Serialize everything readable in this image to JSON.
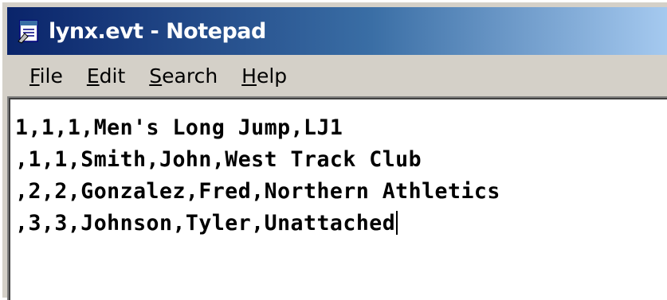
{
  "window": {
    "title": "lynx.evt - Notepad",
    "icon": "notepad-icon"
  },
  "menu": {
    "items": [
      {
        "label_first": "F",
        "label_rest": "ile"
      },
      {
        "label_first": "E",
        "label_rest": "dit"
      },
      {
        "label_first": "S",
        "label_rest": "earch"
      },
      {
        "label_first": "H",
        "label_rest": "elp"
      }
    ]
  },
  "editor": {
    "lines": [
      "1,1,1,Men's Long Jump,LJ1",
      ",1,1,Smith,John,West Track Club",
      ",2,2,Gonzalez,Fred,Northern Athletics",
      ",3,3,Johnson,Tyler,Unattached"
    ]
  },
  "colors": {
    "titlebar_start": "#0a246a",
    "titlebar_end": "#a6caf0",
    "chrome": "#d4d0c8"
  }
}
